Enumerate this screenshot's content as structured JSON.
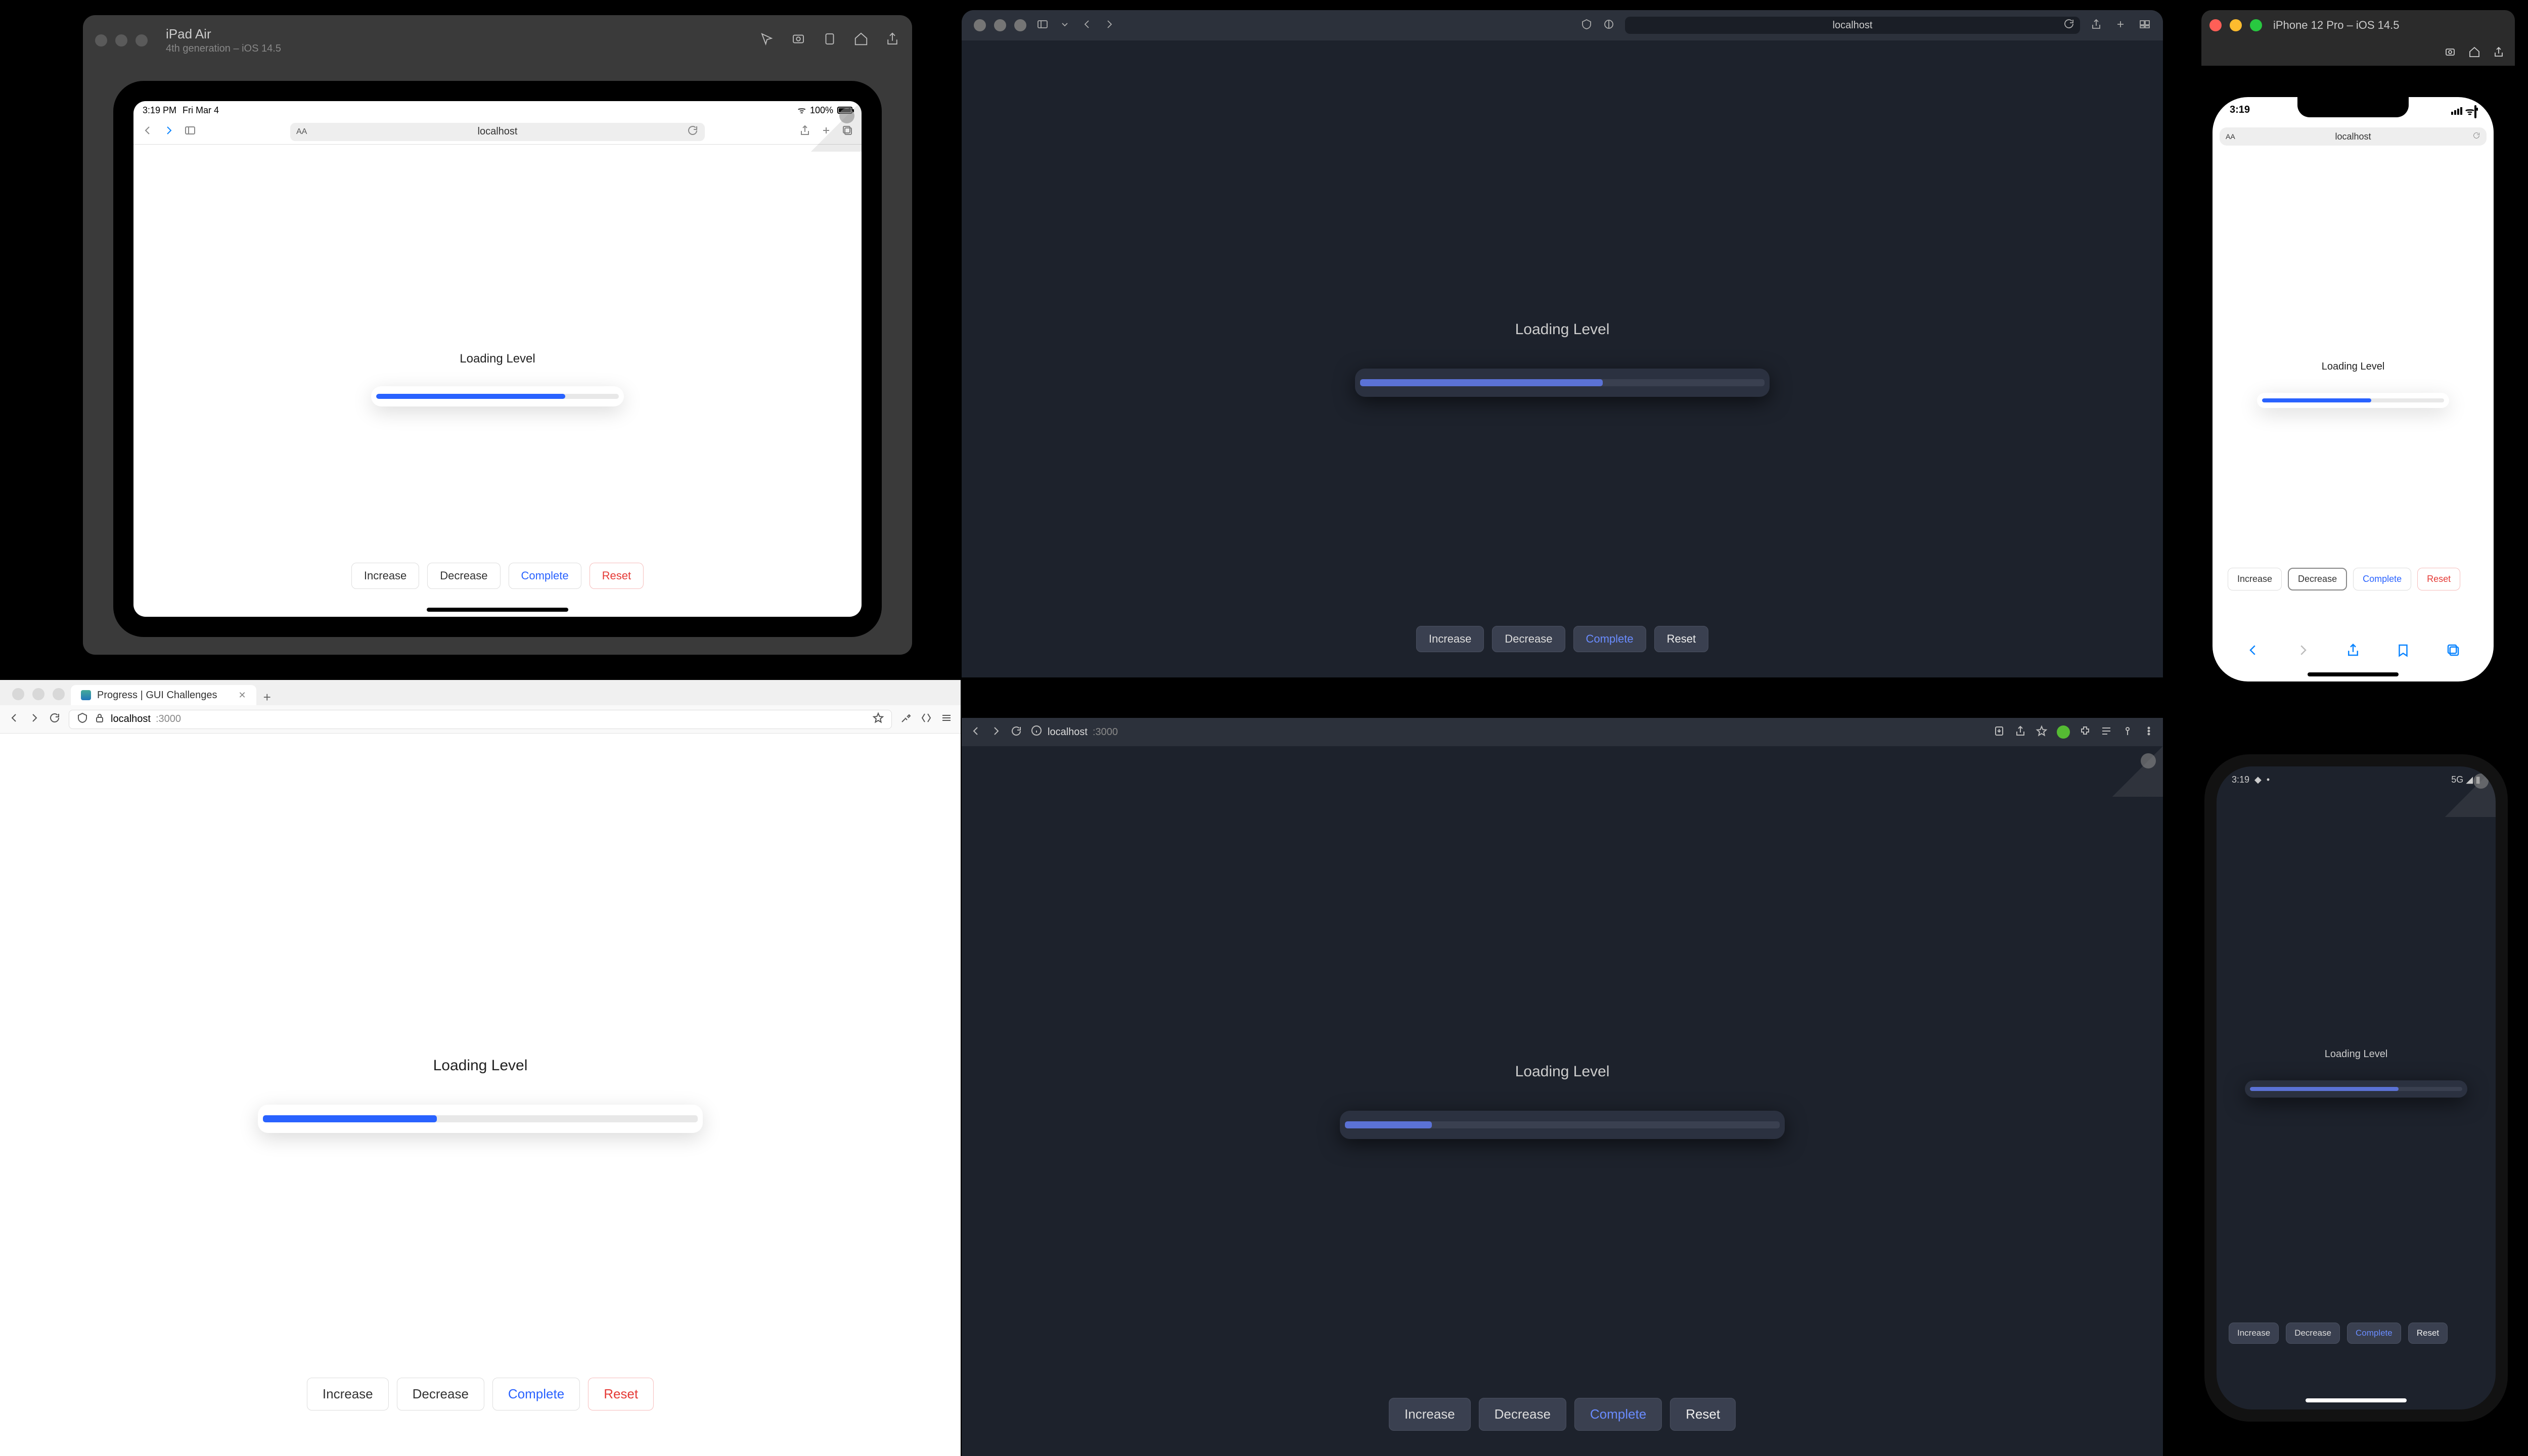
{
  "ipad": {
    "simulator_title": "iPad Air",
    "simulator_subtitle": "4th generation – iOS 14.5",
    "status_time": "3:19 PM",
    "status_date": "Fri Mar 4",
    "status_battery": "100%",
    "url": "localhost",
    "loading_label": "Loading Level",
    "progress_pct": 78,
    "buttons": {
      "increase": "Increase",
      "decrease": "Decrease",
      "complete": "Complete",
      "reset": "Reset"
    }
  },
  "safari": {
    "url": "localhost",
    "loading_label": "Loading Level",
    "progress_pct": 60,
    "buttons": {
      "increase": "Increase",
      "decrease": "Decrease",
      "complete": "Complete",
      "reset": "Reset"
    }
  },
  "iphone": {
    "simulator_title": "iPhone 12 Pro – iOS 14.5",
    "status_time": "3:19",
    "url": "localhost",
    "loading_label": "Loading Level",
    "progress_pct": 60,
    "buttons": {
      "increase": "Increase",
      "decrease": "Decrease",
      "complete": "Complete",
      "reset": "Reset"
    }
  },
  "firefox": {
    "tab_title": "Progress | GUI Challenges",
    "url_host": "localhost",
    "url_port": ":3000",
    "loading_label": "Loading Level",
    "progress_pct": 40,
    "buttons": {
      "increase": "Increase",
      "decrease": "Decrease",
      "complete": "Complete",
      "reset": "Reset"
    }
  },
  "chrome": {
    "url_host": "localhost",
    "url_port": ":3000",
    "loading_label": "Loading Level",
    "progress_pct": 20,
    "buttons": {
      "increase": "Increase",
      "decrease": "Decrease",
      "complete": "Complete",
      "reset": "Reset"
    }
  },
  "android": {
    "status_time": "3:19",
    "status_icons": "5G",
    "loading_label": "Loading Level",
    "progress_pct": 70,
    "buttons": {
      "increase": "Increase",
      "decrease": "Decrease",
      "complete": "Complete",
      "reset": "Reset"
    }
  }
}
